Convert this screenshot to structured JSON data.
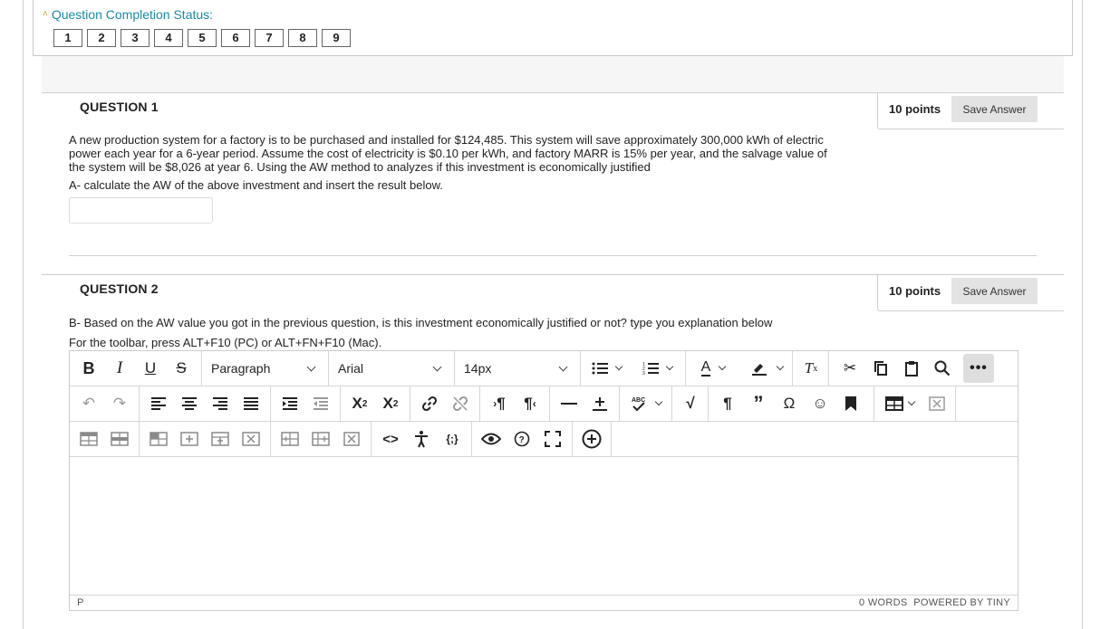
{
  "completion": {
    "title": "Question Completion Status:",
    "numbers": [
      "1",
      "2",
      "3",
      "4",
      "5",
      "6",
      "7",
      "8",
      "9"
    ]
  },
  "question1": {
    "title": "QUESTION 1",
    "points": "10 points",
    "save_label": "Save Answer",
    "body": "A new production system for a factory is to be purchased and installed for $124,485. This system will save approximately 300,000 kWh of electric power each year for a 6-year period. Assume the cost of electricity is $0.10 per kWh, and factory MARR is 15% per year, and the salvage value of the system will be $8,026 at year 6. Using the AW method to analyzes if this investment is economically justified",
    "sub": "A- calculate the AW of the above investment and insert the result below.",
    "answer_value": ""
  },
  "question2": {
    "title": "QUESTION 2",
    "points": "10 points",
    "save_label": "Save Answer",
    "body": "B- Based on the AW value you got in the previous question, is this investment economically  justified or not? type you explanation below",
    "hint": "For the toolbar, press ALT+F10 (PC) or ALT+FN+F10 (Mac)."
  },
  "editor": {
    "format_select": "Paragraph",
    "font_select": "Arial",
    "size_select": "14px",
    "path": "P",
    "word_count": "0 WORDS",
    "powered_by": "POWERED BY TINY",
    "more_label": "•••"
  }
}
